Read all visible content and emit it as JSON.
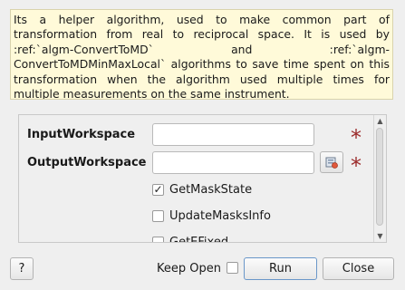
{
  "description": "Its a helper algorithm, used to make common part of transformation from real to reciprocal space. It is used by :ref:`algm-ConvertToMD` and :ref:`algm-ConvertToMDMinMaxLocal` algorithms to save time spent on this transformation when the algorithm used multiple times for multiple measurements on the same instrument.",
  "properties": {
    "input_workspace": {
      "label": "InputWorkspace",
      "value": "",
      "required_marker": "*"
    },
    "output_workspace": {
      "label": "OutputWorkspace",
      "value": "",
      "required_marker": "*"
    }
  },
  "options": [
    {
      "label": "GetMaskState",
      "checked": true,
      "check_glyph": "✓"
    },
    {
      "label": "UpdateMasksInfo",
      "checked": false,
      "check_glyph": ""
    },
    {
      "label": "GetEFixed",
      "checked": false,
      "check_glyph": ""
    }
  ],
  "scrollbar": {
    "up_glyph": "▲",
    "down_glyph": "▼"
  },
  "footer": {
    "help_label": "?",
    "keep_open_label": "Keep Open",
    "keep_open_checked": false,
    "run_label": "Run",
    "close_label": "Close"
  },
  "colors": {
    "description_bg": "#fffad9",
    "required_star": "#9b2a2a",
    "run_border": "#6a97c9"
  }
}
